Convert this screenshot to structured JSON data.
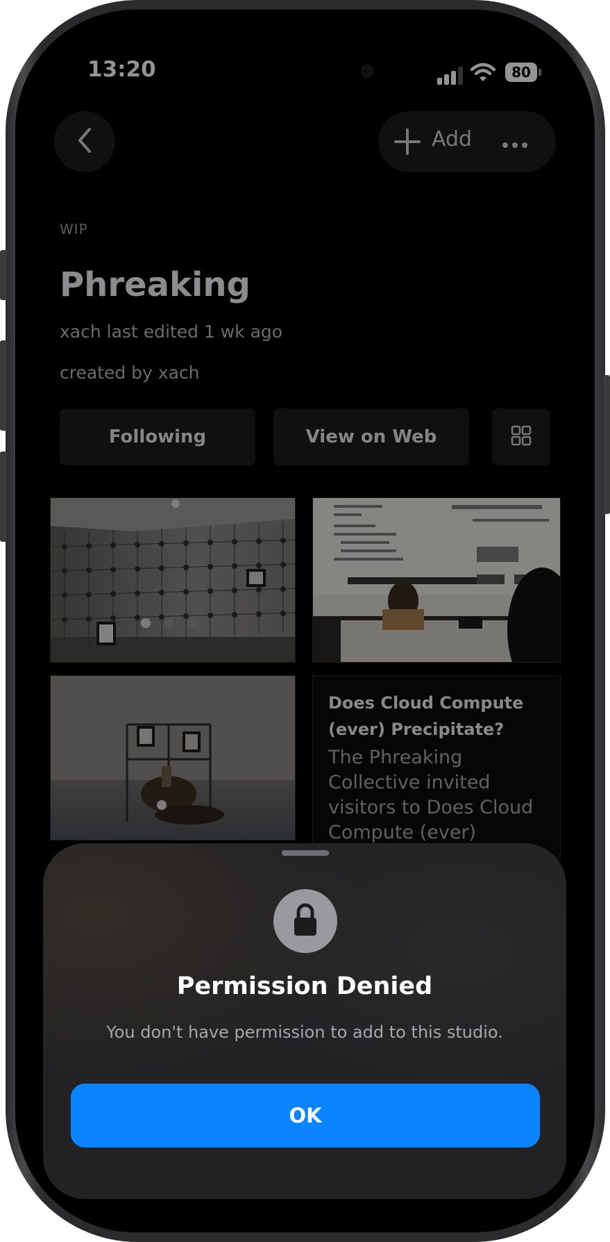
{
  "status_bar": {
    "time": "13:20",
    "battery": "80"
  },
  "header": {
    "back_icon": "chevron-left-icon",
    "add_label": "Add",
    "add_icon": "plus-icon",
    "more_icon": "ellipsis-icon"
  },
  "studio": {
    "label": "WIP",
    "title": "Phreaking",
    "last_edited": "xach last edited 1 wk ago",
    "created_by": "created by xach"
  },
  "actions": {
    "following_label": "Following",
    "view_web_label": "View on Web",
    "grid_icon": "grid-view-icon"
  },
  "content": {
    "text_card": {
      "title": "Does Cloud Compute (ever) Precipitate?",
      "body": "The Phreaking Collective invited visitors to Does Cloud Compute (ever)"
    }
  },
  "dialog": {
    "icon": "lock-icon",
    "title": "Permission Denied",
    "message": "You don't have permission to add to this studio.",
    "ok_label": "OK"
  },
  "colors": {
    "accent": "#0a84ff",
    "background": "#000000",
    "sheet": "#222224"
  }
}
